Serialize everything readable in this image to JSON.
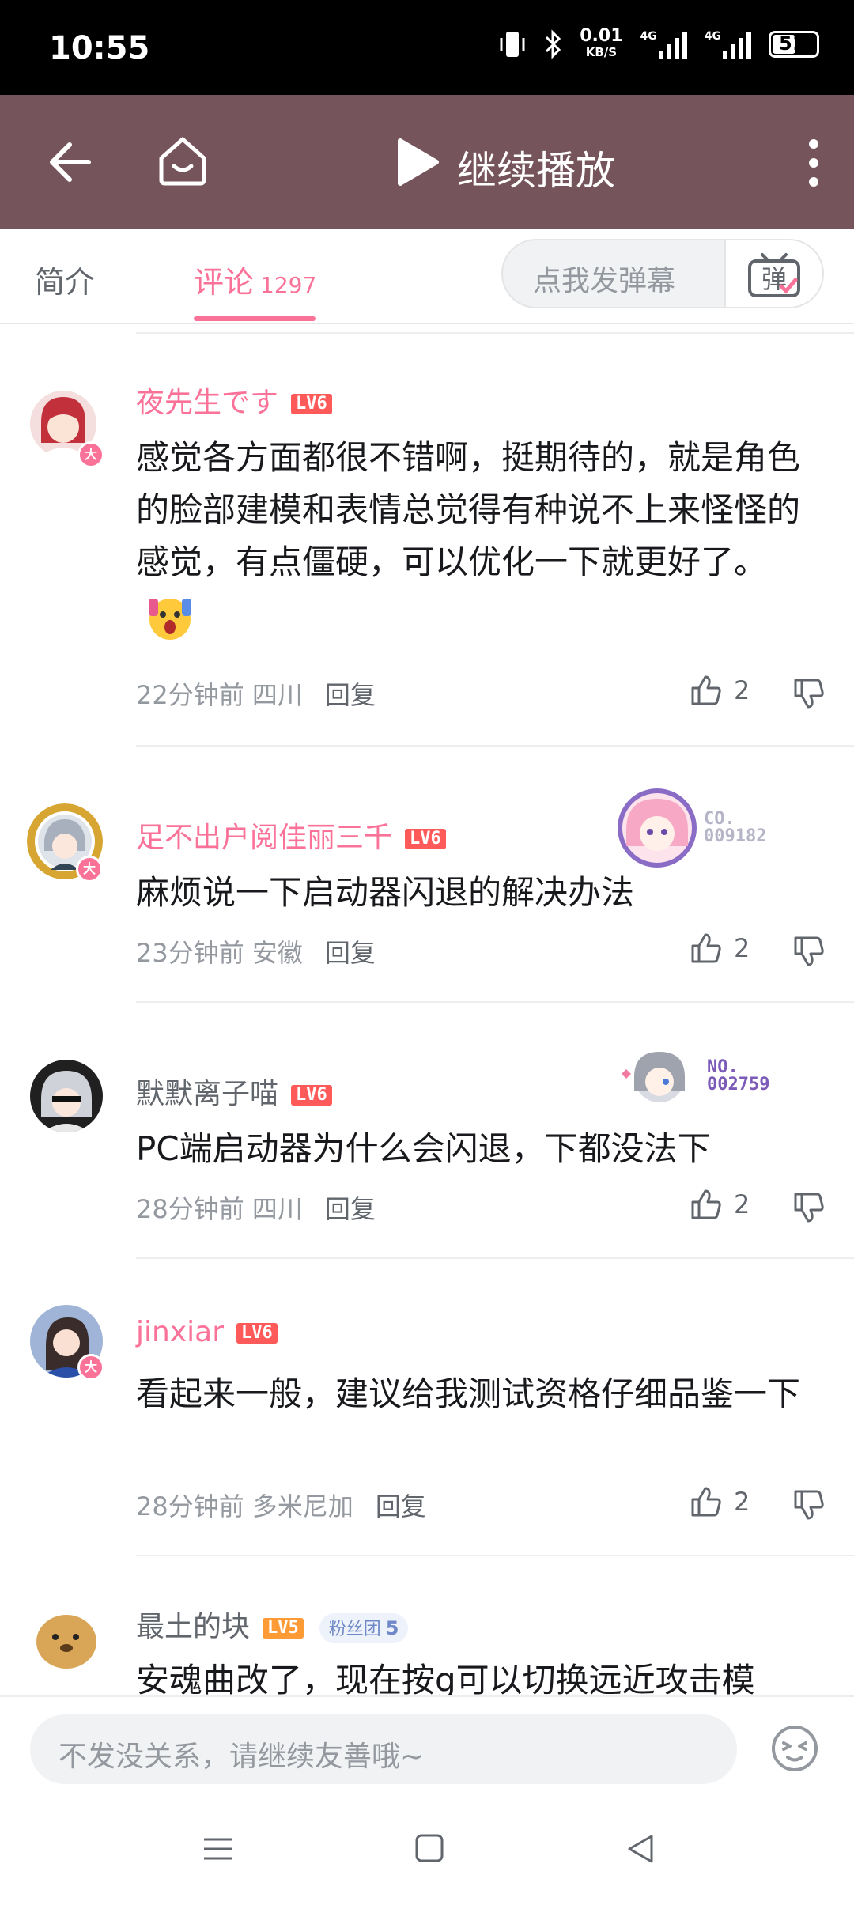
{
  "status_bar": {
    "time": "10:55",
    "net_speed": "0.01",
    "net_unit": "KB/S",
    "net1": "4G",
    "net2": "4G",
    "battery": "51"
  },
  "top_bar": {
    "title": "继续播放"
  },
  "tabs": {
    "intro": "简介",
    "comments": "评论",
    "comment_count": "1297",
    "danmaku_placeholder": "点我发弹幕",
    "danmaku_button": "弹"
  },
  "comments": [
    {
      "user": "夜先生です",
      "level": "LV6",
      "text": "感觉各方面都很不错啊，挺期待的，就是角色的脸部建模和表情总觉得有种说不上来怪怪的感觉，有点僵硬，可以优化一下就更好了。",
      "time": "22分钟前",
      "location": "四川",
      "reply": "回复",
      "likes": "2",
      "badge": "大"
    },
    {
      "user": "足不出户阅佳丽三千",
      "level": "LV6",
      "text": "麻烦说一下启动器闪退的解决办法",
      "time": "23分钟前",
      "location": "安徽",
      "reply": "回复",
      "likes": "2",
      "badge": "大",
      "decor_no": "CO.\n009182"
    },
    {
      "user": "默默离子喵",
      "level": "LV6",
      "text": "PC端启动器为什么会闪退，下都没法下",
      "time": "28分钟前",
      "location": "四川",
      "reply": "回复",
      "likes": "2",
      "decor_no": "NO.\n002759"
    },
    {
      "user": "jinxiar",
      "level": "LV6",
      "text": "看起来一般，建议给我测试资格仔细品鉴一下",
      "time": "28分钟前",
      "location": "多米尼加",
      "reply": "回复",
      "likes": "2",
      "badge": "大"
    },
    {
      "user": "最土的块",
      "level": "LV5",
      "fans_label": "粉丝团",
      "fans_level": "5",
      "text": "安魂曲改了，现在按g可以切换远近攻击模"
    }
  ],
  "composer": {
    "placeholder": "不发没关系，请继续友善哦~"
  },
  "colors": {
    "topbar": "#75555b",
    "accent": "#fb7299",
    "level6": "#ff5a5a",
    "level5": "#ff9b36"
  }
}
